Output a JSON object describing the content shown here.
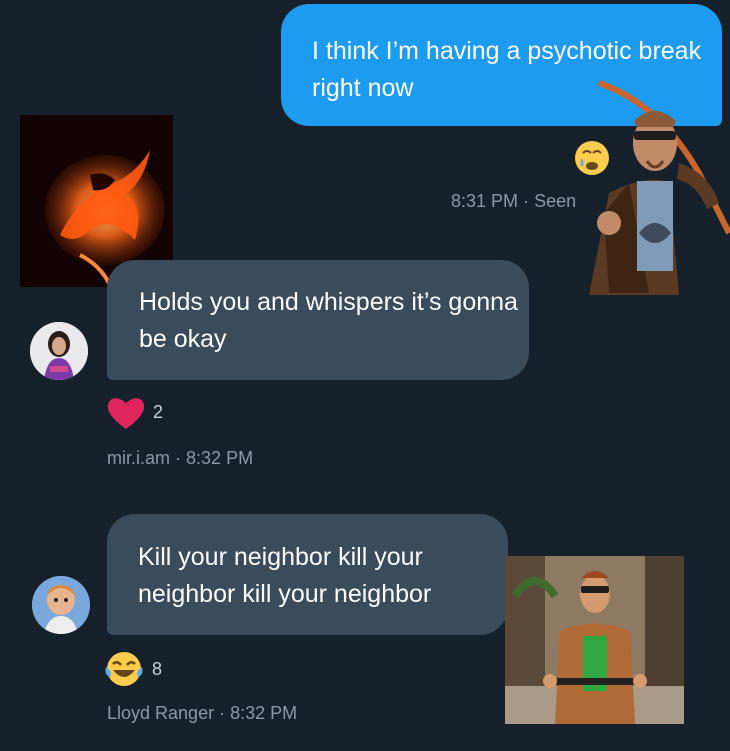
{
  "messages": [
    {
      "text": "I think I’m having a psychotic break right now"
    },
    {
      "text": "Holds you and whispers it’s gonna be okay"
    },
    {
      "text": "Kill your neighbor kill your neighbor kill your neighbor"
    }
  ],
  "reactions": {
    "outgoing_emoji": "😰",
    "heart_count": "2",
    "laugh_count": "8"
  },
  "meta": {
    "outgoing_time": "8:31 PM",
    "seen_label": "Seen",
    "msg1_user": "mir.i.am",
    "msg1_time": "8:32 PM",
    "msg2_user": "Lloyd Ranger",
    "msg2_time": "8:32 PM",
    "separator": "·"
  },
  "colors": {
    "background": "#15202b",
    "outgoing_bubble": "#1d9bf0",
    "incoming_bubble": "#3a4b5c",
    "meta_text": "#8b98a5",
    "heart": "#e0245e"
  },
  "icons": [
    "heart-icon",
    "laughing-emoji-icon",
    "crying-emoji-icon"
  ]
}
